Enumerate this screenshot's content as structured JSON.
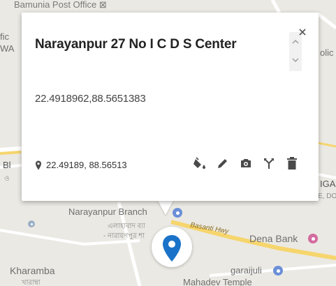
{
  "infowindow": {
    "title": "Narayanpur 27 No I C D S Center",
    "coordinates": "22.4918962,88.5651383",
    "short_coordinates": "22.49189, 88.56513",
    "actions": [
      "paint-bucket-icon",
      "pencil-icon",
      "camera-icon",
      "routing-icon",
      "trash-icon"
    ]
  },
  "map": {
    "labels": {
      "post_office": "Bamunia Post Office ⊠",
      "left_fragment_1": "fic",
      "left_fragment_2": "WA",
      "right_fragment_1": "olic",
      "left_fragment_3": "Bl",
      "left_fragment_4": "ও",
      "right_fragment_2": "IGAI",
      "right_fragment_3": "OFFICE, DOUT",
      "narayanpur_branch": "Narayanpur Branch",
      "narayanpur_bengali_1": "এলাহাবাদ ব্যা",
      "narayanpur_bengali_2": "- নারায়ণপুর শা",
      "basanti_hwy": "Basanti Hwy",
      "dena_bank": "Dena Bank",
      "kharamba": "Kharamba",
      "kharamba_bengali": "খারাম্বা",
      "garaijuli": "garaijuli",
      "mahadev": "Mahadev Temple"
    },
    "colors": {
      "background": "#ebe9e3",
      "road": "#ffffff",
      "highway": "#fbe08a",
      "poi_blue": "#6b8fd8",
      "poi_pink": "#d36b9f",
      "marker": "#1a73c8"
    }
  }
}
